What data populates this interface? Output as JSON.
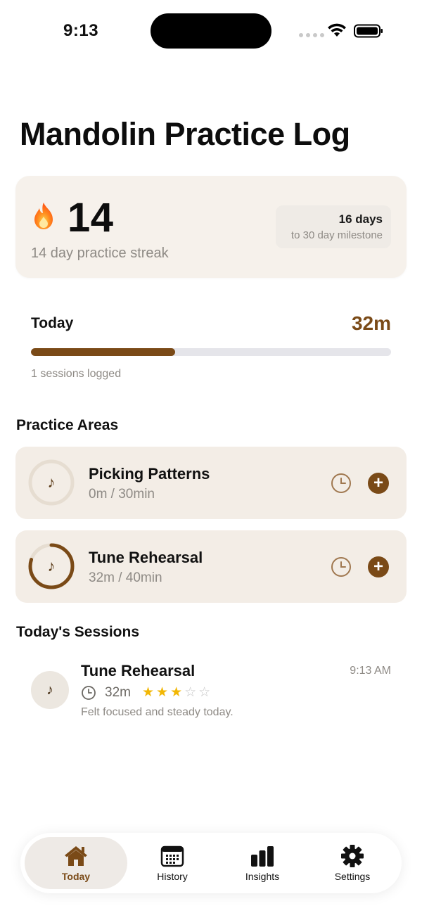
{
  "status_bar": {
    "time": "9:13"
  },
  "page": {
    "title": "Mandolin Practice Log"
  },
  "streak": {
    "count": "14",
    "label": "14 day practice streak",
    "milestone_days": "16 days",
    "milestone_text": "to 30 day milestone"
  },
  "today": {
    "label": "Today",
    "minutes": "32m",
    "progress_percent": 40,
    "sessions_logged": "1 sessions logged"
  },
  "practice_areas": {
    "heading": "Practice Areas",
    "items": [
      {
        "name": "Picking Patterns",
        "progress": "0m / 30min",
        "completion": 0
      },
      {
        "name": "Tune Rehearsal",
        "progress": "32m / 40min",
        "completion": 0.8
      }
    ]
  },
  "sessions": {
    "heading": "Today's Sessions",
    "items": [
      {
        "title": "Tune Rehearsal",
        "time": "9:13 AM",
        "duration": "32m",
        "rating": 3,
        "rating_max": 5,
        "note": "Felt focused and steady today."
      }
    ]
  },
  "tabs": [
    {
      "label": "Today",
      "icon": "house-icon",
      "active": true
    },
    {
      "label": "History",
      "icon": "calendar-icon",
      "active": false
    },
    {
      "label": "Insights",
      "icon": "bar-chart-icon",
      "active": false
    },
    {
      "label": "Settings",
      "icon": "gear-icon",
      "active": false
    }
  ],
  "colors": {
    "accent": "#7a4a17",
    "card_background": "#f6f1eb",
    "area_card_background": "#f3ede6",
    "track": "#e5e5ea",
    "star": "#f2b705"
  }
}
